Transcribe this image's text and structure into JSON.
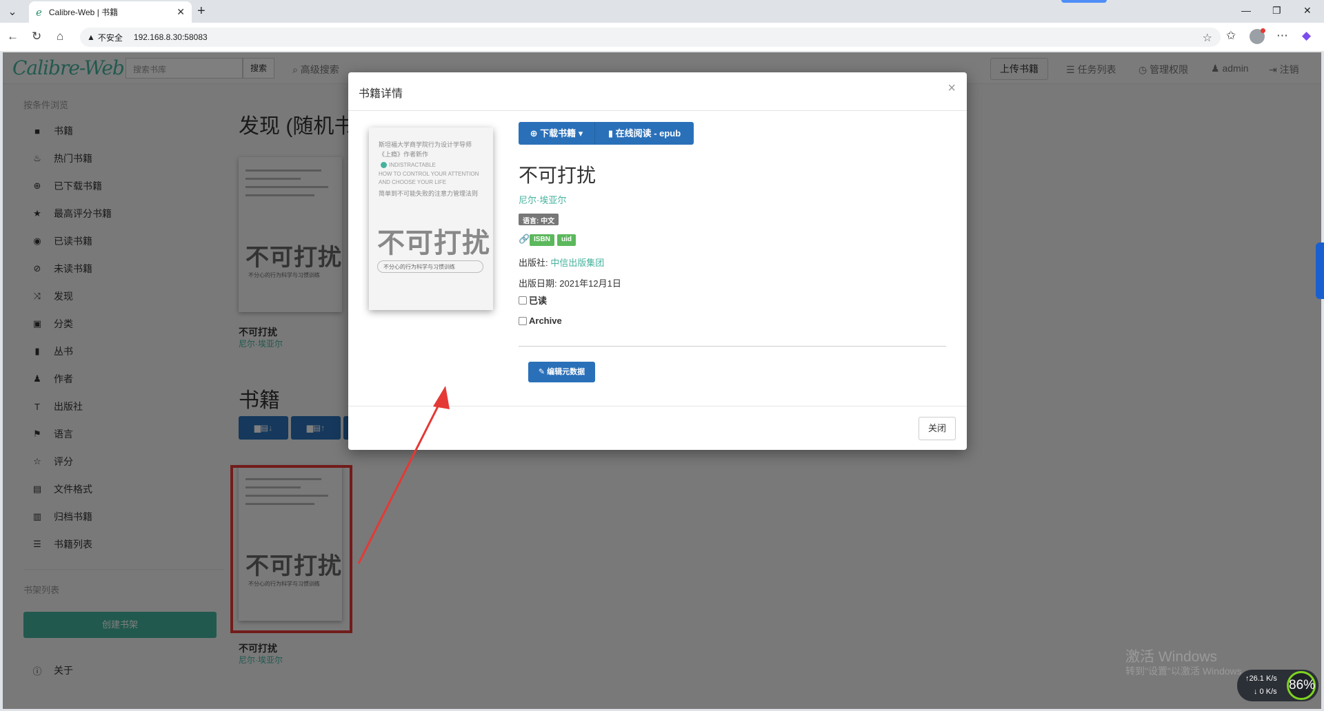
{
  "browser": {
    "tab_title": "Calibre-Web | 书籍",
    "tab_favicon": "e",
    "security_label": "不安全",
    "url": "192.168.8.30:58083"
  },
  "navbar": {
    "logo": "Calibre-Web",
    "search_placeholder": "搜索书库",
    "search_button": "搜索",
    "advanced_search": "高级搜索",
    "upload": "上传书籍",
    "tasks": "任务列表",
    "admin_panel": "管理权限",
    "user": "admin",
    "logout": "注销"
  },
  "sidebar": {
    "browse_header": "按条件浏览",
    "items": [
      {
        "label": "书籍",
        "icon": "book-icon"
      },
      {
        "label": "热门书籍",
        "icon": "fire-icon"
      },
      {
        "label": "已下载书籍",
        "icon": "download-icon"
      },
      {
        "label": "最高评分书籍",
        "icon": "star-icon"
      },
      {
        "label": "已读书籍",
        "icon": "eye-open-icon"
      },
      {
        "label": "未读书籍",
        "icon": "eye-closed-icon"
      },
      {
        "label": "发现",
        "icon": "random-icon"
      },
      {
        "label": "分类",
        "icon": "inbox-icon"
      },
      {
        "label": "丛书",
        "icon": "bookmark-icon"
      },
      {
        "label": "作者",
        "icon": "user-icon"
      },
      {
        "label": "出版社",
        "icon": "text-icon"
      },
      {
        "label": "语言",
        "icon": "flag-icon"
      },
      {
        "label": "评分",
        "icon": "star-empty-icon"
      },
      {
        "label": "文件格式",
        "icon": "file-icon"
      },
      {
        "label": "归档书籍",
        "icon": "trash-icon"
      },
      {
        "label": "书籍列表",
        "icon": "list-icon"
      }
    ],
    "shelf_header": "书架列表",
    "create_shelf": "创建书架",
    "about": "关于"
  },
  "main": {
    "discover_heading": "发现 (随机书",
    "books_heading": "书籍",
    "book": {
      "title": "不可打扰",
      "author": "尼尔·埃亚尔"
    }
  },
  "cover": {
    "line1": "斯坦福大学商学院行为设计学导师",
    "line2": "《上瘾》作者新作",
    "line3": "INDISTRACTABLE",
    "line4": "HOW TO CONTROL YOUR ATTENTION",
    "line5": "AND CHOOSE YOUR LIFE",
    "line6": "简单到不可能失败的注意力管理法则",
    "big_title": "不可打扰",
    "subtitle": "不分心的行为科学与习惯训练"
  },
  "modal": {
    "title": "书籍详情",
    "download_button": "下载书籍",
    "read_button": "在线阅读 - epub",
    "book_title": "不可打扰",
    "author": "尼尔·埃亚尔",
    "language_badge": "语言: 中文",
    "identifiers": [
      "ISBN",
      "uid"
    ],
    "publisher_label": "出版社:",
    "publisher": "中信出版集团",
    "pubdate_label": "出版日期:",
    "pubdate": "2021年12月1日",
    "read_checkbox": "已读",
    "archive_checkbox": "Archive",
    "edit_button": "编辑元数据",
    "close_button": "关闭"
  },
  "system": {
    "watermark_title": "激活 Windows",
    "watermark_sub": "转到\"设置\"以激活 Windows",
    "net_up": "↑26.1 K/s",
    "net_down": "↓ 0 K/s",
    "percent": "86%"
  },
  "colors": {
    "accent": "#45b29d",
    "primary_button": "#2a70b9",
    "annotation": "#e53935"
  }
}
